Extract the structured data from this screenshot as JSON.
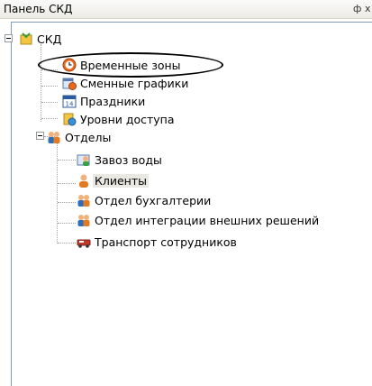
{
  "panel": {
    "title": "Панель СКД",
    "pin_glyph": "ф",
    "close_glyph": "х"
  },
  "tree": {
    "root": {
      "label": "СКД",
      "icon": "skd-folder-icon"
    },
    "items": [
      {
        "label": "Временные зоны",
        "icon": "clock-icon"
      },
      {
        "label": "Сменные графики",
        "icon": "calendar-shift-icon"
      },
      {
        "label": "Праздники",
        "icon": "holiday-calendar-icon"
      },
      {
        "label": "Уровни доступа",
        "icon": "access-level-icon"
      }
    ],
    "departments": {
      "label": "Отделы",
      "icon": "people-group-icon",
      "children": [
        {
          "label": "Завоз воды",
          "icon": "water-delivery-icon"
        },
        {
          "label": "Клиенты",
          "icon": "person-icon",
          "selected": true
        },
        {
          "label": "Отдел бухгалтерии",
          "icon": "people-group-icon"
        },
        {
          "label": "Отдел интеграции внешних решений",
          "icon": "people-group-icon"
        },
        {
          "label": "Транспорт сотрудников",
          "icon": "transport-icon"
        }
      ]
    }
  },
  "colors": {
    "border": "#7f9db9",
    "selection": "#e9e8e2"
  }
}
